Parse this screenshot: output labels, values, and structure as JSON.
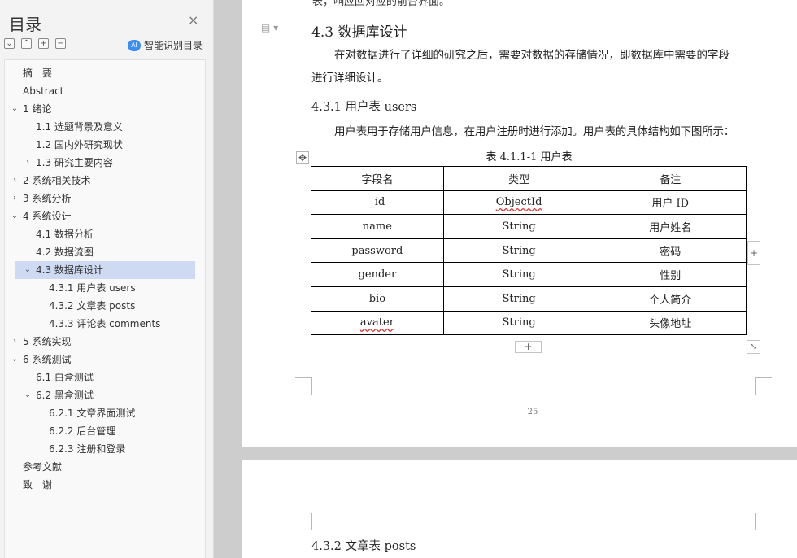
{
  "sidebar": {
    "title": "目录",
    "close_icon": "×",
    "tools": [
      "⌄",
      "⌃",
      "+",
      "−"
    ],
    "ai_icon_glyph": "AI",
    "ai_label": "智能识别目录",
    "items": [
      {
        "label": "摘　要",
        "level": 0,
        "chevron": ""
      },
      {
        "label": "Abstract",
        "level": 0,
        "chevron": ""
      },
      {
        "label": "1 绪论",
        "level": 0,
        "chevron": "⌄"
      },
      {
        "label": "1.1 选题背景及意义",
        "level": 1,
        "chevron": ""
      },
      {
        "label": "1.2 国内外研究现状",
        "level": 1,
        "chevron": ""
      },
      {
        "label": "1.3 研究主要内容",
        "level": 1,
        "chevron": "›"
      },
      {
        "label": "2 系统相关技术",
        "level": 0,
        "chevron": "›"
      },
      {
        "label": "3 系统分析",
        "level": 0,
        "chevron": "›"
      },
      {
        "label": "4 系统设计",
        "level": 0,
        "chevron": "⌄"
      },
      {
        "label": "4.1 数据分析",
        "level": 1,
        "chevron": ""
      },
      {
        "label": "4.2 数据流图",
        "level": 1,
        "chevron": ""
      },
      {
        "label": "4.3 数据库设计",
        "level": 1,
        "chevron": "⌄",
        "active": true
      },
      {
        "label": "4.3.1 用户表 users",
        "level": 2,
        "chevron": ""
      },
      {
        "label": "4.3.2 文章表 posts",
        "level": 2,
        "chevron": ""
      },
      {
        "label": "4.3.3 评论表 comments",
        "level": 2,
        "chevron": ""
      },
      {
        "label": "5 系统实现",
        "level": 0,
        "chevron": "›"
      },
      {
        "label": "6 系统测试",
        "level": 0,
        "chevron": "⌄"
      },
      {
        "label": "6.1 白盒测试",
        "level": 1,
        "chevron": ""
      },
      {
        "label": "6.2 黑盒测试",
        "level": 1,
        "chevron": "⌄"
      },
      {
        "label": "6.2.1 文章界面测试",
        "level": 2,
        "chevron": ""
      },
      {
        "label": "6.2.2 后台管理",
        "level": 2,
        "chevron": ""
      },
      {
        "label": "6.2.3 注册和登录",
        "level": 2,
        "chevron": ""
      },
      {
        "label": "参考文献",
        "level": 0,
        "chevron": ""
      },
      {
        "label": "致　谢",
        "level": 0,
        "chevron": ""
      }
    ]
  },
  "doc": {
    "cut_line": "表，响应回对应的前台界面。",
    "heading_43": "4.3 数据库设计",
    "para_43_line1": "在对数据进行了详细的研究之后，需要对数据的存储情况，即数据库中需要的字段",
    "para_43_line2": "进行详细设计。",
    "heading_431": "4.3.1 用户表 users",
    "para_431": "用户表用于存储用户信息，在用户注册时进行添加。用户表的具体结构如下图所示：",
    "caption": "表 4.1.1-1  用户表",
    "table": {
      "headers": [
        "字段名",
        "类型",
        "备注"
      ],
      "rows": [
        [
          "_id",
          "ObjectId",
          "用户 ID"
        ],
        [
          "name",
          "String",
          "用户姓名"
        ],
        [
          "password",
          "String",
          "密码"
        ],
        [
          "gender",
          "String",
          "性别"
        ],
        [
          "bio",
          "String",
          "个人简介"
        ],
        [
          "avater",
          "String",
          "头像地址"
        ]
      ]
    },
    "page_number": "25",
    "heading_432": "4.3.2 文章表 posts",
    "move_icon": "✥",
    "add_icon": "+",
    "resize_icon": "⤡",
    "doc_menu_icon": "▤ ▾"
  }
}
